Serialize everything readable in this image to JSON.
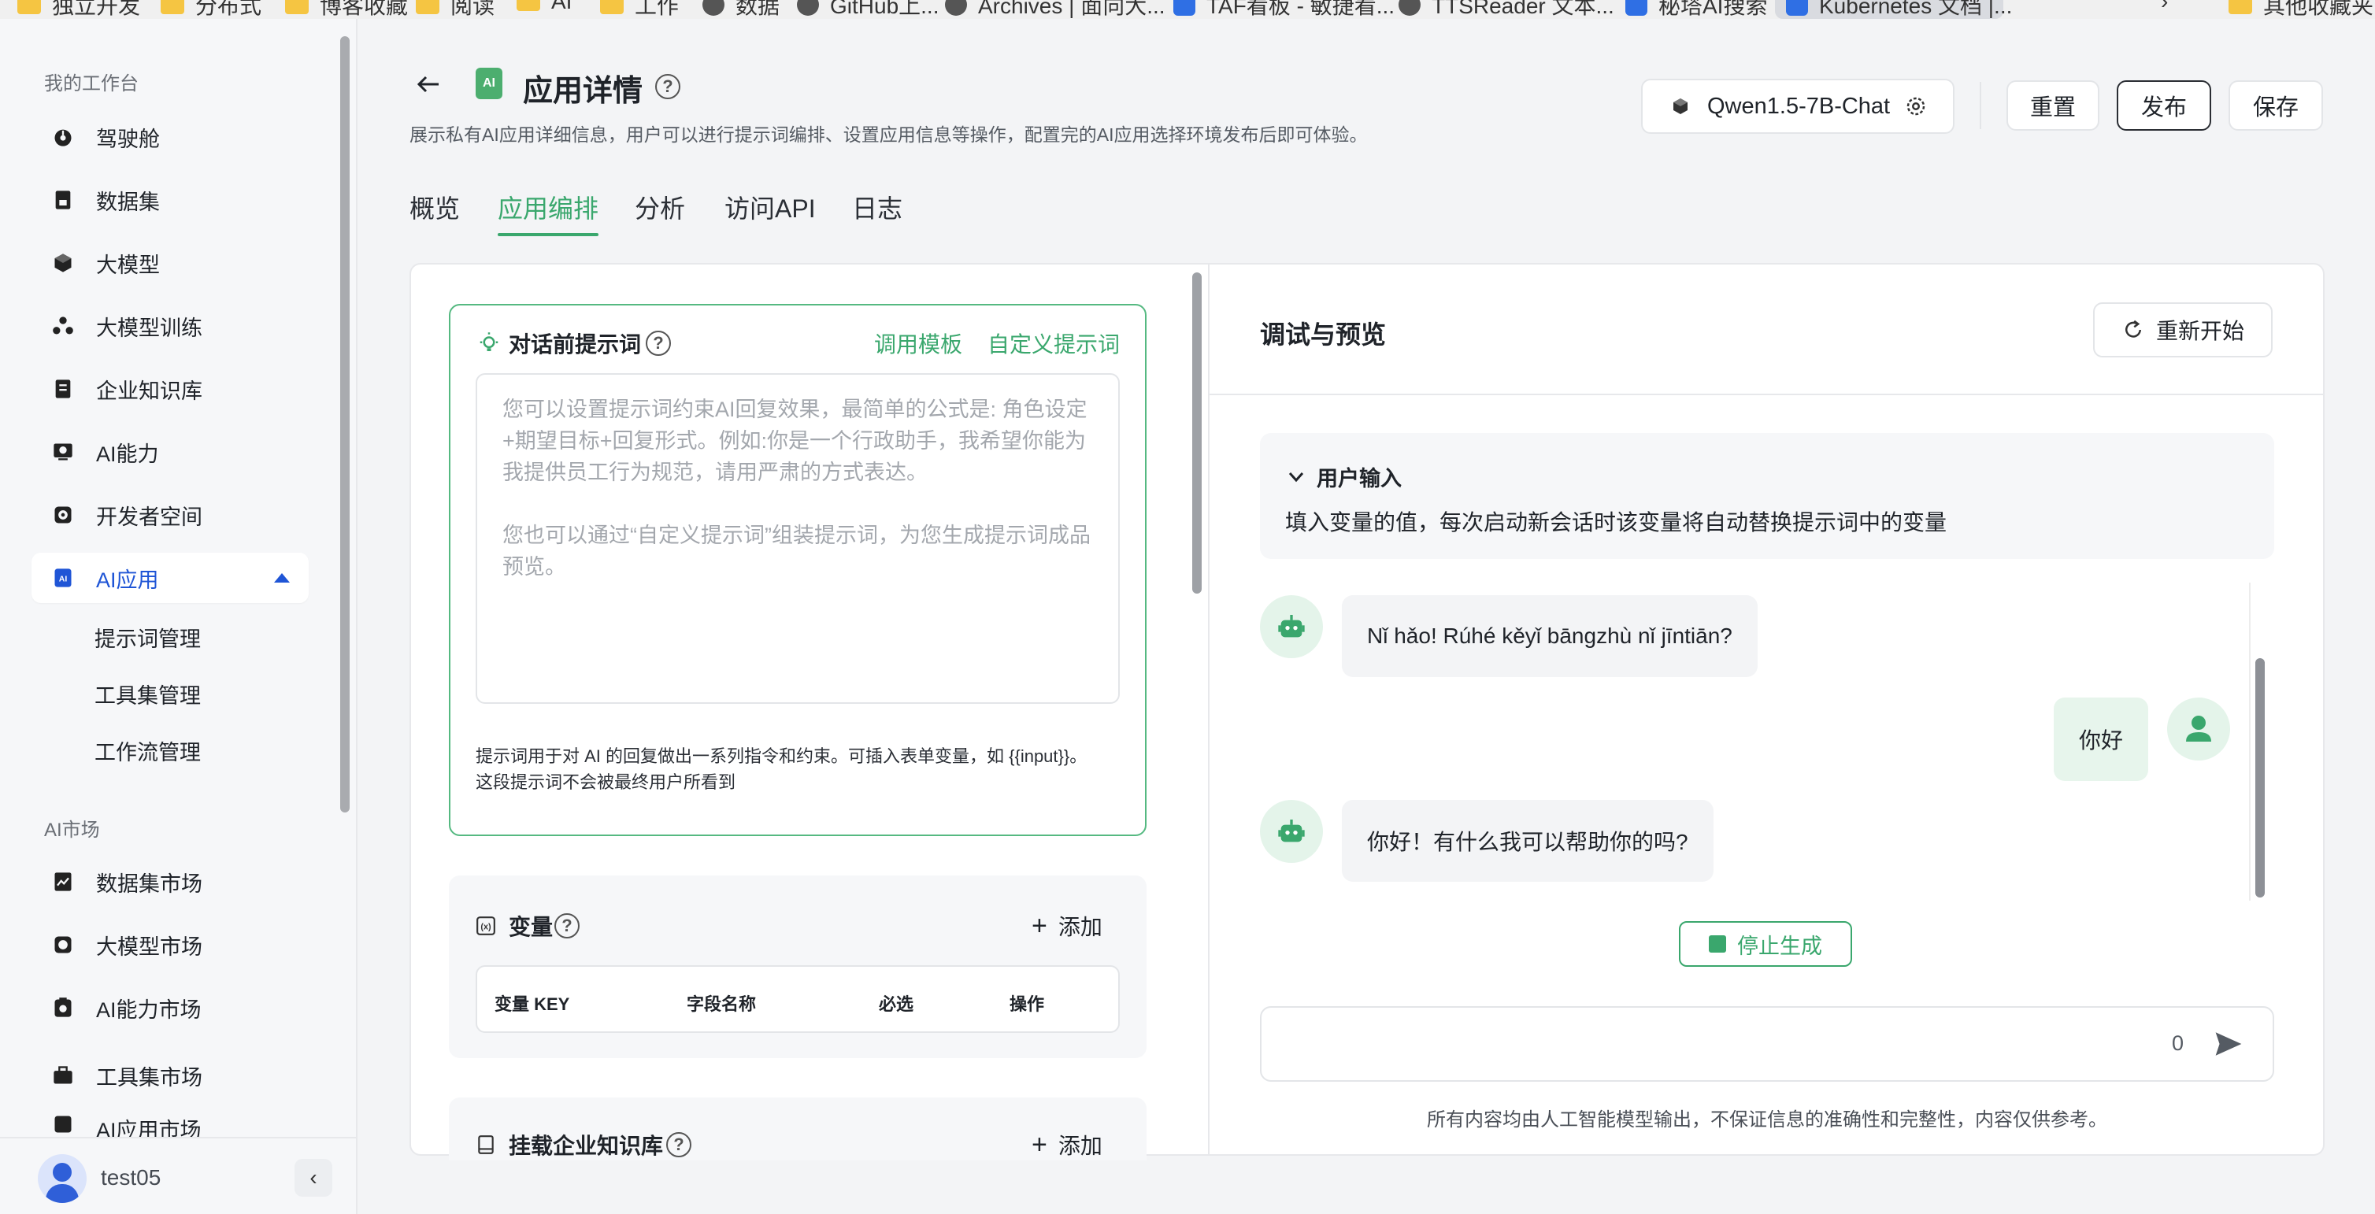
{
  "bookmarks": [
    "独立开发",
    "分布式",
    "博客收藏",
    "阅读",
    "AI",
    "工作",
    "数据",
    "GitHub上...",
    "Archives | 面向大...",
    "TAF看板 - 敏捷看...",
    "TTSReader 文本...",
    "秘塔AI搜索",
    "Kubernetes 文档 |...",
    "其他收藏夹"
  ],
  "sidebar": {
    "workspace_title": "我的工作台",
    "items": [
      {
        "label": "驾驶舱",
        "icon": "dashboard-icon"
      },
      {
        "label": "数据集",
        "icon": "dataset-icon"
      },
      {
        "label": "大模型",
        "icon": "cube-icon"
      },
      {
        "label": "大模型训练",
        "icon": "training-icon"
      },
      {
        "label": "企业知识库",
        "icon": "knowledge-base-icon"
      },
      {
        "label": "AI能力",
        "icon": "ai-ability-icon"
      },
      {
        "label": "开发者空间",
        "icon": "developer-icon"
      },
      {
        "label": "AI应用",
        "icon": "ai-app-icon"
      }
    ],
    "sub_items": [
      "提示词管理",
      "工具集管理",
      "工作流管理"
    ],
    "market_title": "AI市场",
    "market_items": [
      {
        "label": "数据集市场",
        "icon": "dataset-market-icon"
      },
      {
        "label": "大模型市场",
        "icon": "model-market-icon"
      },
      {
        "label": "AI能力市场",
        "icon": "ai-market-icon"
      },
      {
        "label": "工具集市场",
        "icon": "toolset-market-icon"
      },
      {
        "label": "AI应用市场",
        "icon": "app-market-icon"
      }
    ],
    "username": "test05"
  },
  "header": {
    "title": "应用详情",
    "app_icon_text": "AI",
    "description": "展示私有AI应用详细信息，用户可以进行提示词编排、设置应用信息等操作，配置完的AI应用选择环境发布后即可体验。",
    "model": "Qwen1.5-7B-Chat",
    "reset_label": "重置",
    "publish_label": "发布",
    "save_label": "保存"
  },
  "tabs": [
    {
      "label": "概览",
      "active": false
    },
    {
      "label": "应用编排",
      "active": true
    },
    {
      "label": "分析",
      "active": false
    },
    {
      "label": "访问API",
      "active": false
    },
    {
      "label": "日志",
      "active": false
    }
  ],
  "prompt": {
    "title": "对话前提示词",
    "template_link": "调用模板",
    "custom_link": "自定义提示词",
    "placeholder_1": "您可以设置提示词约束AI回复效果，最简单的公式是: 角色设定+期望目标+回复形式。例如:你是一个行政助手，我希望你能为我提供员工行为规范，请用严肃的方式表达。",
    "placeholder_2": "您也可以通过“自定义提示词”组装提示词，为您生成提示词成品预览。",
    "note": "提示词用于对 AI 的回复做出一系列指令和约束。可插入表单变量，如 {{input}}。 这段提示词不会被最终用户所看到"
  },
  "variables": {
    "title": "变量",
    "add_label": "添加",
    "columns": [
      "变量 KEY",
      "字段名称",
      "必选",
      "操作"
    ]
  },
  "knowledge": {
    "title": "挂载企业知识库",
    "add_label": "添加"
  },
  "preview": {
    "title": "调试与预览",
    "restart_label": "重新开始",
    "user_input_title": "用户输入",
    "user_input_desc": "填入变量的值，每次启动新会话时该变量将自动替换提示词中的变量",
    "messages": [
      {
        "role": "bot",
        "text": "Nǐ hǎo! Rúhé kěyǐ bāngzhù nǐ jīntiān?"
      },
      {
        "role": "user",
        "text": "你好"
      },
      {
        "role": "bot",
        "text": "你好！有什么我可以帮助你的吗?"
      }
    ],
    "stop_label": "停止生成",
    "char_count": "0",
    "disclaimer": "所有内容均由人工智能模型输出，不保证信息的准确性和完整性，内容仅供参考。"
  },
  "colors": {
    "accent_green": "#3aa76d",
    "active_blue": "#1f55d6"
  }
}
